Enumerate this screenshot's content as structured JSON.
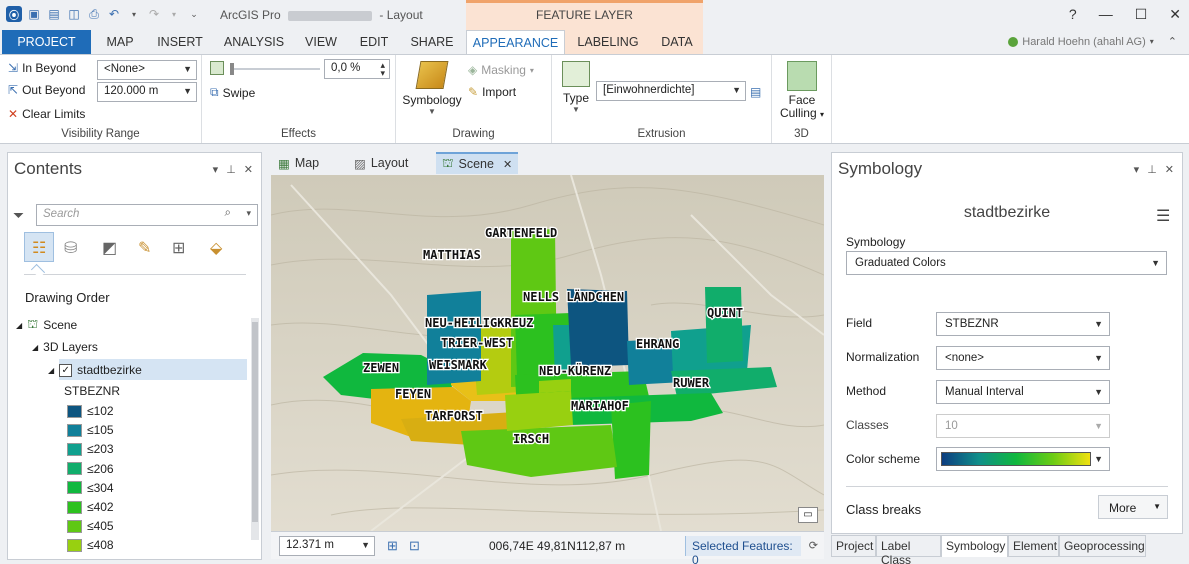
{
  "window": {
    "app_name": "ArcGIS Pro",
    "title_suffix": "- Layout",
    "contextual_tab_group": "FEATURE LAYER",
    "help": "?",
    "user_name": "Harald Hoehn (ahahl AG)"
  },
  "ribbon_tabs": [
    "PROJECT",
    "MAP",
    "INSERT",
    "ANALYSIS",
    "VIEW",
    "EDIT",
    "SHARE",
    "APPEARANCE",
    "LABELING",
    "DATA"
  ],
  "ribbon": {
    "visibility_range": {
      "label": "Visibility Range",
      "in_beyond": "In Beyond",
      "out_beyond": "Out Beyond",
      "clear_limits": "Clear Limits",
      "in_value": "<None>",
      "out_value": "120.000 m"
    },
    "effects": {
      "label": "Effects",
      "transparency": "0,0 %",
      "swipe": "Swipe"
    },
    "drawing": {
      "label": "Drawing",
      "symbology": "Symbology",
      "masking": "Masking",
      "import": "Import"
    },
    "extrusion": {
      "label": "Extrusion",
      "type": "Type",
      "field": "[Einwohnerdichte]"
    },
    "three_d": {
      "label": "3D",
      "face_culling_1": "Face",
      "face_culling_2": "Culling"
    }
  },
  "contents": {
    "title": "Contents",
    "search_placeholder": "Search",
    "drawing_order": "Drawing Order",
    "scene": "Scene",
    "layers_3d": "3D Layers",
    "layer": "stadtbezirke",
    "field": "STBEZNR",
    "legend": [
      {
        "label": "≤102",
        "color": "#0d5580"
      },
      {
        "label": "≤105",
        "color": "#11809a"
      },
      {
        "label": "≤203",
        "color": "#10a08e"
      },
      {
        "label": "≤206",
        "color": "#11ad6b"
      },
      {
        "label": "≤304",
        "color": "#10b83e"
      },
      {
        "label": "≤402",
        "color": "#2cc11f"
      },
      {
        "label": "≤405",
        "color": "#5fc814"
      },
      {
        "label": "≤408",
        "color": "#98d010"
      }
    ]
  },
  "views": {
    "tabs": [
      "Map",
      "Layout",
      "Scene"
    ],
    "map_labels": [
      "GARTENFELD",
      "MATTHIAS",
      "NELLS LÄNDCHEN",
      "QUINT",
      "NEU-HEILIGKREUZ",
      "TRIER-WEST",
      "EHRANG",
      "ZEWEN",
      "WEISMARK",
      "NEU-KÜRENZ",
      "RUWER",
      "FEYEN",
      "MARIAHOF",
      "TARFORST",
      "IRSCH"
    ],
    "scale": "12.371 m",
    "coords": "006,74E 49,81N",
    "elevation": "112,87 m",
    "selected": "Selected Features: 0"
  },
  "symbology": {
    "title": "Symbology",
    "layer": "stadtbezirke",
    "symbology_label": "Symbology",
    "symbology_value": "Graduated Colors",
    "field_label": "Field",
    "field_value": "STBEZNR",
    "normalization_label": "Normalization",
    "normalization_value": "<none>",
    "method_label": "Method",
    "method_value": "Manual Interval",
    "classes_label": "Classes",
    "classes_value": "10",
    "color_scheme_label": "Color scheme",
    "class_breaks": "Class breaks",
    "more": "More",
    "bottom_tabs": [
      "Project",
      "Label Class",
      "Symbology",
      "Element",
      "Geoprocessing"
    ]
  }
}
